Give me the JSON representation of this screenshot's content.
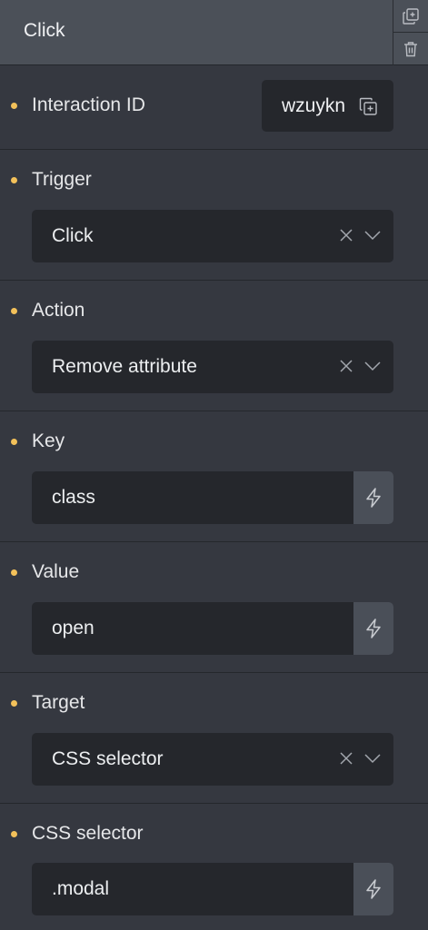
{
  "header": {
    "title": "Click"
  },
  "interaction_id": {
    "label": "Interaction ID",
    "value": "wzuykn"
  },
  "trigger": {
    "label": "Trigger",
    "value": "Click"
  },
  "action": {
    "label": "Action",
    "value": "Remove attribute"
  },
  "key": {
    "label": "Key",
    "value": "class"
  },
  "value_field": {
    "label": "Value",
    "value": "open"
  },
  "target": {
    "label": "Target",
    "value": "CSS selector"
  },
  "css_selector": {
    "label": "CSS selector",
    "value": ".modal"
  },
  "colors": {
    "accent_dot": "#f3c15a",
    "panel": "#353840",
    "field": "#25272c",
    "header": "#4b5058"
  },
  "icons": [
    "duplicate-icon",
    "trash-icon",
    "copy-icon",
    "clear-icon",
    "chevron-down-icon",
    "lightning-icon"
  ]
}
